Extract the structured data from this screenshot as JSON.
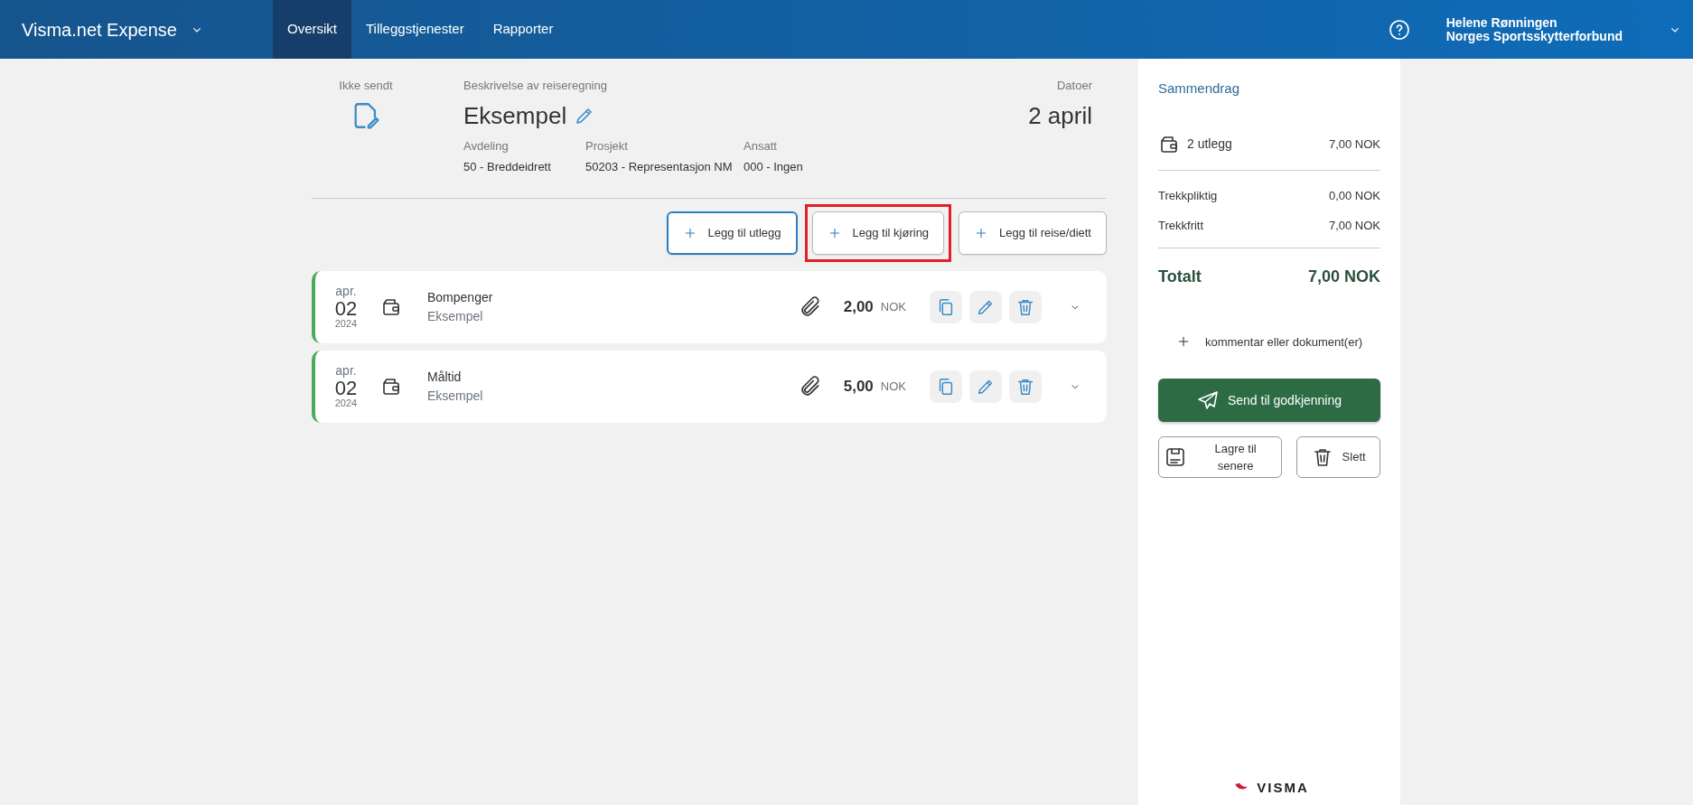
{
  "app": {
    "title": "Visma.net Expense"
  },
  "nav": [
    {
      "label": "Oversikt",
      "selected": true
    },
    {
      "label": "Tilleggstjenester",
      "selected": false
    },
    {
      "label": "Rapporter",
      "selected": false
    }
  ],
  "user": {
    "name": "Helene Rønningen",
    "organization": "Norges Sportsskytterforbund"
  },
  "report": {
    "status": "Ikke sendt",
    "description_label": "Beskrivelse av reiseregning",
    "description": "Eksempel",
    "dates_label": "Datoer",
    "dates": "2 april",
    "fields": [
      {
        "label": "Avdeling",
        "value": "50 - Breddeidrett"
      },
      {
        "label": "Prosjekt",
        "value": "50203 - Representasjon NM"
      },
      {
        "label": "Ansatt",
        "value": "000 - Ingen"
      }
    ]
  },
  "add_buttons": [
    {
      "label": "Legg til utlegg",
      "focused": true,
      "highlighted": false
    },
    {
      "label": "Legg til kjøring",
      "focused": false,
      "highlighted": true
    },
    {
      "label": "Legg til reise/diett",
      "focused": false,
      "highlighted": false
    }
  ],
  "expenses": [
    {
      "month": "apr.",
      "day": "02",
      "year": "2024",
      "title": "Bompenger",
      "subtitle": "Eksempel",
      "amount": "2,00",
      "currency": "NOK"
    },
    {
      "month": "apr.",
      "day": "02",
      "year": "2024",
      "title": "Måltid",
      "subtitle": "Eksempel",
      "amount": "5,00",
      "currency": "NOK"
    }
  ],
  "summary": {
    "title": "Sammendrag",
    "count": "2 utlegg",
    "count_amount": "7,00 NOK",
    "lines": [
      {
        "label": "Trekkpliktig",
        "amount": "0,00 NOK"
      },
      {
        "label": "Trekkfritt",
        "amount": "7,00 NOK"
      }
    ],
    "total_label": "Totalt",
    "total": "7,00 NOK",
    "comment": "kommentar eller dokument(er)",
    "send": "Send til godkjenning",
    "save": "Lagre til senere",
    "delete": "Slett"
  },
  "footer_logo": "VISMA"
}
